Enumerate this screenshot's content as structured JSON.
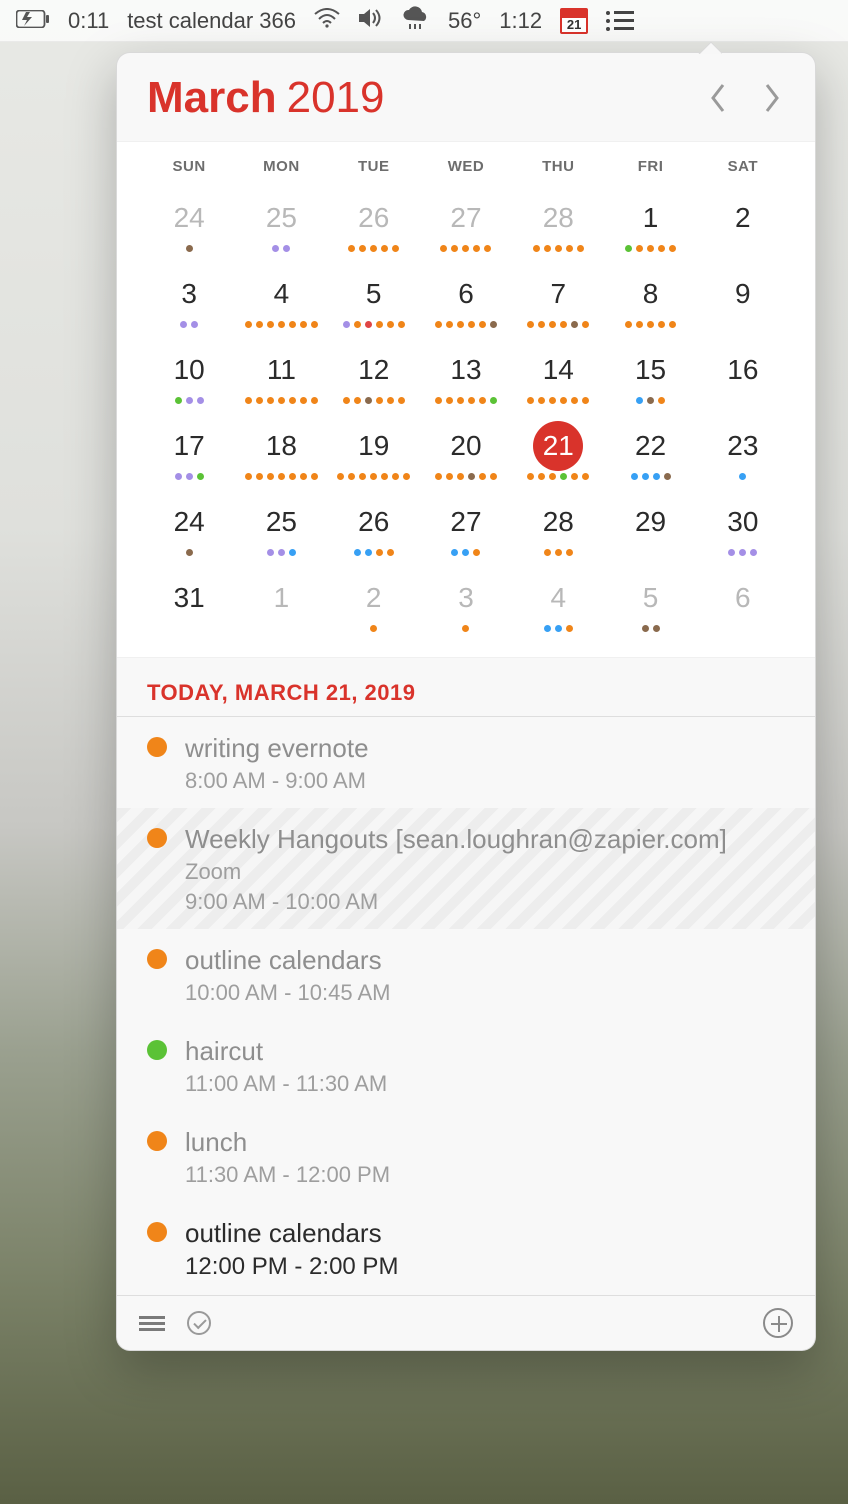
{
  "menubar": {
    "countdown": "0:11",
    "countdown_text": "test calendar 366",
    "temp": "56°",
    "clock": "1:12",
    "calendar_icon_day": "21"
  },
  "header": {
    "month": "March",
    "year": "2019"
  },
  "dow": [
    "SUN",
    "MON",
    "TUE",
    "WED",
    "THU",
    "FRI",
    "SAT"
  ],
  "weeks": [
    [
      {
        "n": "24",
        "cls": "other",
        "dots": [
          "br"
        ]
      },
      {
        "n": "25",
        "cls": "other",
        "dots": [
          "pu",
          "pu"
        ]
      },
      {
        "n": "26",
        "cls": "other",
        "dots": [
          "o",
          "o",
          "o",
          "o",
          "o"
        ]
      },
      {
        "n": "27",
        "cls": "other",
        "dots": [
          "o",
          "o",
          "o",
          "o",
          "o"
        ]
      },
      {
        "n": "28",
        "cls": "other",
        "dots": [
          "o",
          "o",
          "o",
          "o",
          "o"
        ]
      },
      {
        "n": "1",
        "cls": "",
        "dots": [
          "g",
          "o",
          "o",
          "o",
          "o"
        ]
      },
      {
        "n": "2",
        "cls": "",
        "dots": []
      }
    ],
    [
      {
        "n": "3",
        "cls": "",
        "dots": [
          "pu",
          "pu"
        ]
      },
      {
        "n": "4",
        "cls": "",
        "dots": [
          "o",
          "o",
          "o",
          "o",
          "o",
          "o",
          "o"
        ]
      },
      {
        "n": "5",
        "cls": "",
        "dots": [
          "pu",
          "o",
          "r",
          "o",
          "o",
          "o"
        ]
      },
      {
        "n": "6",
        "cls": "",
        "dots": [
          "o",
          "o",
          "o",
          "o",
          "o",
          "br"
        ]
      },
      {
        "n": "7",
        "cls": "",
        "dots": [
          "o",
          "o",
          "o",
          "o",
          "br",
          "o"
        ]
      },
      {
        "n": "8",
        "cls": "",
        "dots": [
          "o",
          "o",
          "o",
          "o",
          "o"
        ]
      },
      {
        "n": "9",
        "cls": "",
        "dots": []
      }
    ],
    [
      {
        "n": "10",
        "cls": "",
        "dots": [
          "g",
          "pu",
          "pu"
        ]
      },
      {
        "n": "11",
        "cls": "",
        "dots": [
          "o",
          "o",
          "o",
          "o",
          "o",
          "o",
          "o"
        ]
      },
      {
        "n": "12",
        "cls": "",
        "dots": [
          "o",
          "o",
          "br",
          "o",
          "o",
          "o"
        ]
      },
      {
        "n": "13",
        "cls": "",
        "dots": [
          "o",
          "o",
          "o",
          "o",
          "o",
          "g"
        ]
      },
      {
        "n": "14",
        "cls": "",
        "dots": [
          "o",
          "o",
          "o",
          "o",
          "o",
          "o"
        ]
      },
      {
        "n": "15",
        "cls": "",
        "dots": [
          "bl",
          "br",
          "o"
        ]
      },
      {
        "n": "16",
        "cls": "",
        "dots": []
      }
    ],
    [
      {
        "n": "17",
        "cls": "",
        "dots": [
          "pu",
          "pu",
          "g"
        ]
      },
      {
        "n": "18",
        "cls": "",
        "dots": [
          "o",
          "o",
          "o",
          "o",
          "o",
          "o",
          "o"
        ]
      },
      {
        "n": "19",
        "cls": "",
        "dots": [
          "o",
          "o",
          "o",
          "o",
          "o",
          "o",
          "o"
        ]
      },
      {
        "n": "20",
        "cls": "",
        "dots": [
          "o",
          "o",
          "o",
          "br",
          "o",
          "o"
        ]
      },
      {
        "n": "21",
        "cls": "selected",
        "dots": [
          "o",
          "o",
          "o",
          "g",
          "o",
          "o"
        ]
      },
      {
        "n": "22",
        "cls": "",
        "dots": [
          "bl",
          "bl",
          "bl",
          "br"
        ]
      },
      {
        "n": "23",
        "cls": "",
        "dots": [
          "bl"
        ]
      }
    ],
    [
      {
        "n": "24",
        "cls": "",
        "dots": [
          "br"
        ]
      },
      {
        "n": "25",
        "cls": "",
        "dots": [
          "pu",
          "pu",
          "bl"
        ]
      },
      {
        "n": "26",
        "cls": "",
        "dots": [
          "bl",
          "bl",
          "o",
          "o"
        ]
      },
      {
        "n": "27",
        "cls": "",
        "dots": [
          "bl",
          "bl",
          "o"
        ]
      },
      {
        "n": "28",
        "cls": "",
        "dots": [
          "o",
          "o",
          "o"
        ]
      },
      {
        "n": "29",
        "cls": "",
        "dots": []
      },
      {
        "n": "30",
        "cls": "",
        "dots": [
          "pu",
          "pu",
          "pu"
        ]
      }
    ],
    [
      {
        "n": "31",
        "cls": "",
        "dots": []
      },
      {
        "n": "1",
        "cls": "other",
        "dots": []
      },
      {
        "n": "2",
        "cls": "other",
        "dots": [
          "o"
        ]
      },
      {
        "n": "3",
        "cls": "other",
        "dots": [
          "o"
        ]
      },
      {
        "n": "4",
        "cls": "other",
        "dots": [
          "bl",
          "bl",
          "o"
        ]
      },
      {
        "n": "5",
        "cls": "other",
        "dots": [
          "br",
          "br"
        ]
      },
      {
        "n": "6",
        "cls": "other",
        "dots": []
      }
    ]
  ],
  "today_label": "TODAY, MARCH 21, 2019",
  "events": [
    {
      "title": "writing evernote",
      "sub": "",
      "time": "8:00 AM - 9:00 AM",
      "color": "o",
      "variant": "past"
    },
    {
      "title": "Weekly Hangouts [sean.loughran@zapier.com]",
      "sub": "Zoom",
      "time": "9:00 AM - 10:00 AM",
      "color": "o",
      "variant": "striped"
    },
    {
      "title": "outline calendars",
      "sub": "",
      "time": "10:00 AM - 10:45 AM",
      "color": "o",
      "variant": "past"
    },
    {
      "title": "haircut",
      "sub": "",
      "time": "11:00 AM - 11:30 AM",
      "color": "g",
      "variant": "past"
    },
    {
      "title": "lunch",
      "sub": "",
      "time": "11:30 AM - 12:00 PM",
      "color": "o",
      "variant": "past"
    },
    {
      "title": "outline calendars",
      "sub": "",
      "time": "12:00 PM - 2:00 PM",
      "color": "o",
      "variant": "upcoming"
    }
  ]
}
